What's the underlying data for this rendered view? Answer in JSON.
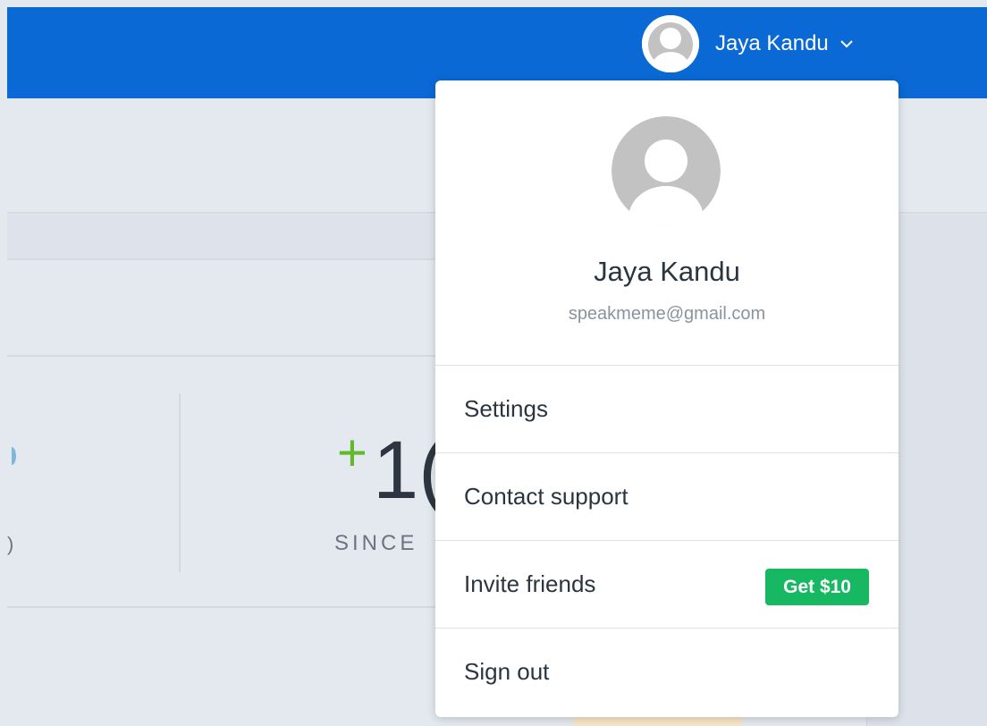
{
  "header": {
    "user_name": "Jaya Kandu",
    "brand_color": "#0a69d4",
    "avatar_icon": "default-user-avatar",
    "chevron_icon": "chevron-down-icon"
  },
  "background": {
    "stat_prefix": "+",
    "stat_value_partial": "1(",
    "stat_caption_partial": "SINCE",
    "left_caption_partial": ")"
  },
  "dropdown": {
    "avatar_icon": "default-user-avatar",
    "name": "Jaya Kandu",
    "email": "speakmeme@gmail.com",
    "items": [
      {
        "label": "Settings"
      },
      {
        "label": "Contact support"
      },
      {
        "label": "Invite friends",
        "badge": "Get $10",
        "badge_color": "#16b961"
      },
      {
        "label": "Sign out"
      }
    ]
  }
}
